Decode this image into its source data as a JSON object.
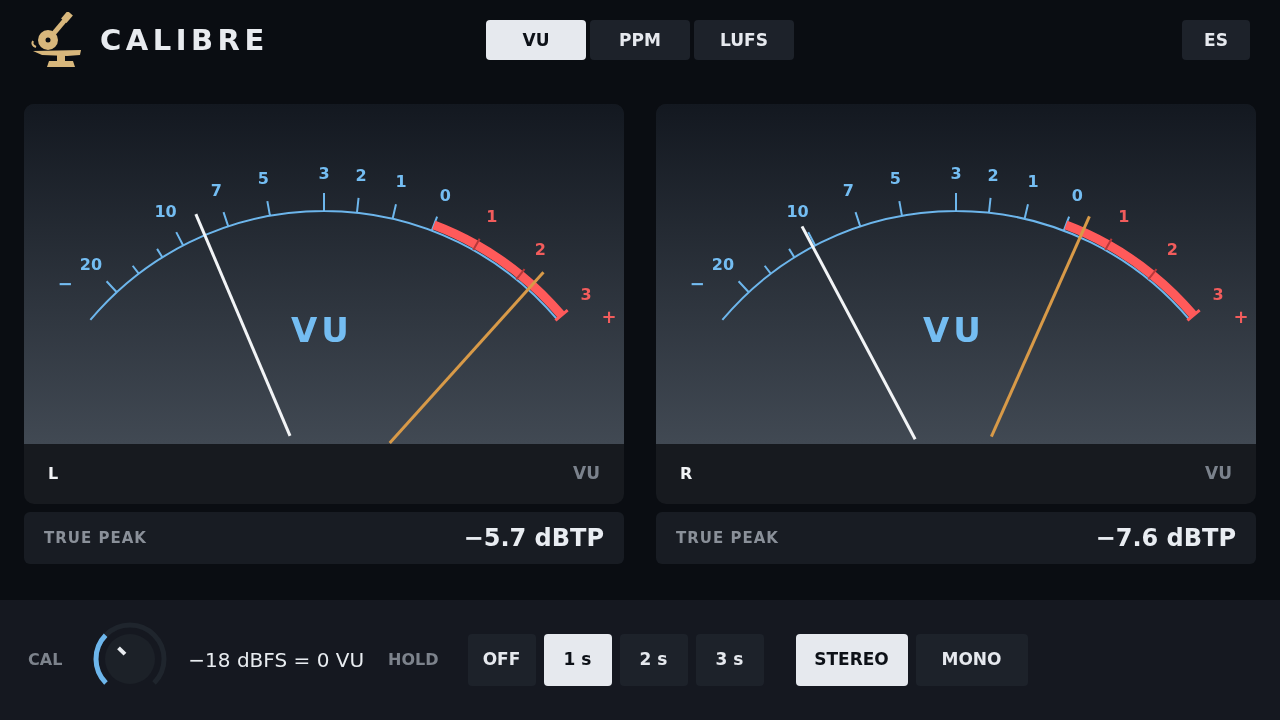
{
  "header": {
    "app_name": "CALIBRE",
    "mode_tabs": [
      {
        "label": "VU",
        "selected": true
      },
      {
        "label": "PPM",
        "selected": false
      },
      {
        "label": "LUFS",
        "selected": false
      }
    ],
    "language_button": "ES"
  },
  "meters": [
    {
      "face_label": "VU",
      "scale": [
        {
          "label": "−",
          "kind": "sign",
          "over": false
        },
        {
          "label": "20",
          "kind": "value",
          "over": false
        },
        {
          "label": "10",
          "kind": "value",
          "over": false
        },
        {
          "label": "7",
          "kind": "value",
          "over": false
        },
        {
          "label": "5",
          "kind": "value",
          "over": false
        },
        {
          "label": "3",
          "kind": "value",
          "over": false
        },
        {
          "label": "2",
          "kind": "value",
          "over": false
        },
        {
          "label": "1",
          "kind": "value",
          "over": false
        },
        {
          "label": "0",
          "kind": "value",
          "over": false
        },
        {
          "label": "1",
          "kind": "value",
          "over": true
        },
        {
          "label": "2",
          "kind": "value",
          "over": true
        },
        {
          "label": "3",
          "kind": "value",
          "over": true
        },
        {
          "label": "+",
          "kind": "sign",
          "over": true
        }
      ],
      "needles": [
        {
          "kind": "vu",
          "level": 0.27
        },
        {
          "kind": "peak",
          "level": 0.92
        }
      ],
      "channel": "L",
      "unit": "VU",
      "true_peak": {
        "label": "TRUE PEAK",
        "value": "−5.7 dBTP"
      }
    },
    {
      "face_label": "VU",
      "scale": [
        {
          "label": "−",
          "kind": "sign",
          "over": false
        },
        {
          "label": "20",
          "kind": "value",
          "over": false
        },
        {
          "label": "10",
          "kind": "value",
          "over": false
        },
        {
          "label": "7",
          "kind": "value",
          "over": false
        },
        {
          "label": "5",
          "kind": "value",
          "over": false
        },
        {
          "label": "3",
          "kind": "value",
          "over": false
        },
        {
          "label": "2",
          "kind": "value",
          "over": false
        },
        {
          "label": "1",
          "kind": "value",
          "over": false
        },
        {
          "label": "0",
          "kind": "value",
          "over": false
        },
        {
          "label": "1",
          "kind": "value",
          "over": true
        },
        {
          "label": "2",
          "kind": "value",
          "over": true
        },
        {
          "label": "3",
          "kind": "value",
          "over": true
        },
        {
          "label": "+",
          "kind": "sign",
          "over": true
        }
      ],
      "needles": [
        {
          "kind": "vu",
          "level": 0.22
        },
        {
          "kind": "peak",
          "level": 0.74
        }
      ],
      "channel": "R",
      "unit": "VU",
      "true_peak": {
        "label": "TRUE PEAK",
        "value": "−7.6 dBTP"
      }
    }
  ],
  "bottom_bar": {
    "cal": {
      "label": "CAL",
      "level": 0.33,
      "reading": "−18 dBFS = 0 VU"
    },
    "hold": {
      "label": "HOLD",
      "options": [
        {
          "label": "OFF",
          "selected": false
        },
        {
          "label": "1 s",
          "selected": true
        },
        {
          "label": "2 s",
          "selected": false
        },
        {
          "label": "3 s",
          "selected": false
        }
      ]
    },
    "channel_mode": {
      "options": [
        {
          "label": "STEREO",
          "selected": true
        },
        {
          "label": "MONO",
          "selected": false
        }
      ]
    }
  }
}
